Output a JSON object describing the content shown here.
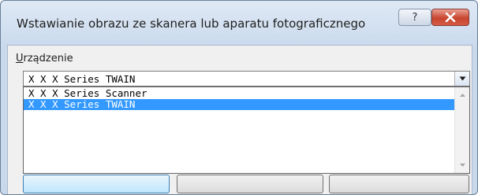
{
  "window": {
    "title": "Wstawianie obrazu ze skanera lub aparatu fotograficznego",
    "help_label": "?",
    "close_icon": "close-icon"
  },
  "device_group": {
    "label_first_letter": "U",
    "label_rest": "rządzenie"
  },
  "device_select": {
    "selected_value": "X X X Series TWAIN",
    "options": [
      {
        "label": "X X X Series Scanner",
        "selected": false
      },
      {
        "label": "X X X Series TWAIN",
        "selected": true
      }
    ]
  },
  "colors": {
    "selection": "#3399ff",
    "close_button": "#c8452f"
  }
}
